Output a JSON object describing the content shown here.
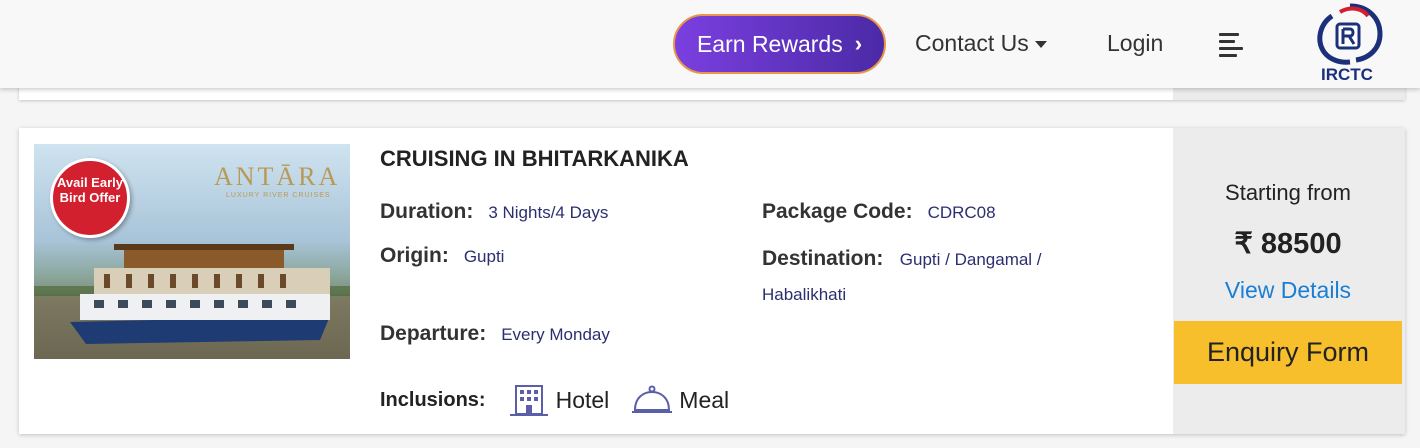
{
  "header": {
    "earn_rewards_label": "Earn Rewards",
    "contact_label": "Contact Us",
    "login_label": "Login",
    "logo_text": "IRCTC"
  },
  "package": {
    "image": {
      "badge_text": "Avail Early Bird Offer",
      "brand": "ANTĀRA",
      "brand_sub": "LUXURY RIVER CRUISES"
    },
    "title": "CRUISING IN BHITARKANIKA",
    "duration_label": "Duration:",
    "duration": "3 Nights/4 Days",
    "code_label": "Package Code:",
    "code": "CDRC08",
    "origin_label": "Origin:",
    "origin": "Gupti",
    "destination_label": "Destination:",
    "destination": "Gupti / Dangamal / Habalikhati",
    "departure_label": "Departure:",
    "departure": "Every Monday",
    "inclusions_label": "Inclusions:",
    "inclusions": [
      {
        "label": "Hotel",
        "icon": "hotel-icon"
      },
      {
        "label": "Meal",
        "icon": "meal-icon"
      }
    ],
    "starting_label": "Starting from",
    "price": "₹ 88500",
    "view_details_label": "View Details",
    "enquiry_label": "Enquiry Form"
  },
  "colors": {
    "accent_purple": "#6a35d4",
    "link_blue": "#1a7ed4",
    "enquiry_yellow": "#f7bf2c",
    "value_navy": "#2b2f6f"
  }
}
